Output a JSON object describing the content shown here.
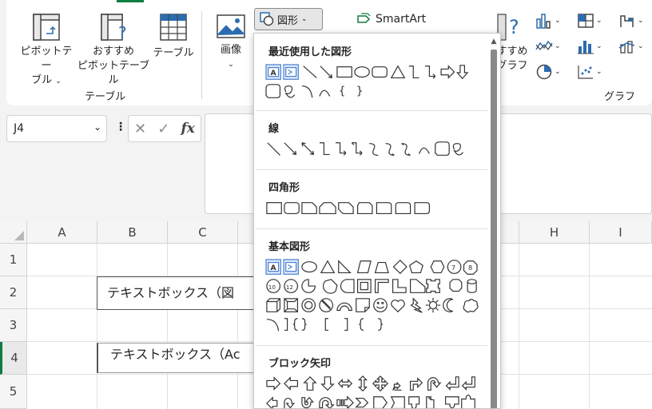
{
  "ribbon": {
    "pivot_table_label_1": "ピボットテー",
    "pivot_table_label_2": "ブル",
    "recommended_pivot_label_1": "おすすめ",
    "recommended_pivot_label_2": "ピボットテーブル",
    "table_label": "テーブル",
    "tables_group_label": "テーブル",
    "image_label": "画像",
    "shapes_label": "図形",
    "smartart_label": "SmartArt",
    "recommended_charts_label_1": "すすめ",
    "recommended_charts_label_2": "グラフ",
    "charts_group_label": "グラフ"
  },
  "formula_bar": {
    "name_box_value": "J4",
    "fx_label": "fx",
    "cancel_glyph": "✕",
    "enter_glyph": "✓"
  },
  "grid": {
    "columns": [
      "A",
      "B",
      "C",
      "H",
      "I"
    ],
    "rows": [
      "1",
      "2",
      "3",
      "4",
      "5"
    ],
    "textbox1": "テキストボックス（図",
    "textbox2": "テキストボックス（Ac"
  },
  "shapes_panel": {
    "sections": [
      {
        "title": "最近使用した図形"
      },
      {
        "title": "線"
      },
      {
        "title": "四角形"
      },
      {
        "title": "基本図形"
      },
      {
        "title": "ブロック矢印"
      }
    ],
    "brackets_row": [
      "(",
      "[",
      "]",
      "{",
      "}",
      "[",
      "]",
      "{",
      "}"
    ]
  },
  "colors": {
    "accent_green": "#107c41",
    "selection_blue": "#4a7fd4"
  }
}
